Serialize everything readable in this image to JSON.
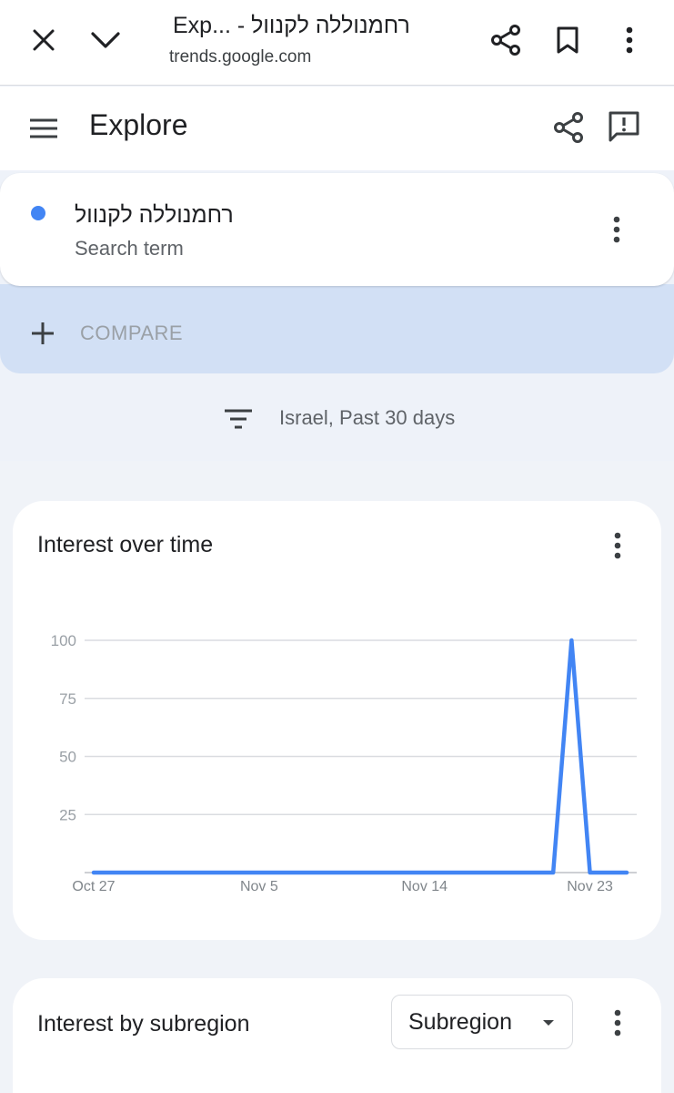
{
  "browser": {
    "title": "Exp... - רחמנוללה לקנוול",
    "url": "trends.google.com"
  },
  "app": {
    "title": "Explore"
  },
  "search_term": {
    "name": "רחמנוללה לקנוול",
    "subtitle": "Search term",
    "color": "#4285f4"
  },
  "compare": {
    "label": "COMPARE"
  },
  "filter": {
    "label": "Israel, Past 30 days"
  },
  "interest_over_time": {
    "title": "Interest over time"
  },
  "interest_by_subregion": {
    "title": "Interest by subregion",
    "dropdown_value": "Subregion"
  },
  "icons": {
    "close": "close-icon",
    "chevron": "chevron-down-icon",
    "share": "share-icon",
    "bookmark": "bookmark-icon",
    "more": "more-vert-icon",
    "menu": "menu-icon",
    "feedback": "feedback-icon",
    "add": "add-icon",
    "filter": "filter-icon",
    "dropdown_arrow": "arrow-drop-down-icon"
  },
  "colors": {
    "accent": "#4285f4",
    "compare_bg": "#d2e0f5",
    "page_bg": "#eef2f9"
  },
  "chart_data": {
    "type": "line",
    "title": "Interest over time",
    "x_tick_labels": [
      "Oct 27",
      "Nov 5",
      "Nov 14",
      "Nov 23"
    ],
    "y_tick_labels": [
      "100",
      "75",
      "50",
      "25"
    ],
    "ylim": [
      0,
      100
    ],
    "grid": true,
    "series": [
      {
        "color": "#4285f4",
        "x": [
          "Oct 27",
          "Oct 28",
          "Oct 29",
          "Oct 30",
          "Oct 31",
          "Nov 1",
          "Nov 2",
          "Nov 3",
          "Nov 4",
          "Nov 5",
          "Nov 6",
          "Nov 7",
          "Nov 8",
          "Nov 9",
          "Nov 10",
          "Nov 11",
          "Nov 12",
          "Nov 13",
          "Nov 14",
          "Nov 15",
          "Nov 16",
          "Nov 17",
          "Nov 18",
          "Nov 19",
          "Nov 20",
          "Nov 21",
          "Nov 22",
          "Nov 23",
          "Nov 24",
          "Nov 25"
        ],
        "values": [
          0,
          0,
          0,
          0,
          0,
          0,
          0,
          0,
          0,
          0,
          0,
          0,
          0,
          0,
          0,
          0,
          0,
          0,
          0,
          0,
          0,
          0,
          0,
          0,
          0,
          0,
          100,
          0,
          0,
          0
        ]
      }
    ]
  }
}
